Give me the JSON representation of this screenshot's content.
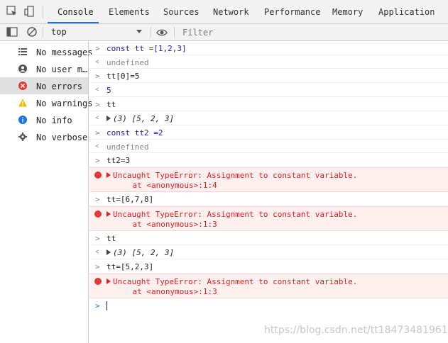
{
  "tabs": [
    "Console",
    "Elements",
    "Sources",
    "Network",
    "Performance",
    "Memory",
    "Application"
  ],
  "active_tab": "Console",
  "toolbar": {
    "context": "top",
    "filter_placeholder": "Filter"
  },
  "sidebar": [
    {
      "icon": "list-icon",
      "label": "No messages"
    },
    {
      "icon": "user-icon",
      "label": "No user m…"
    },
    {
      "icon": "error-icon",
      "label": "No errors"
    },
    {
      "icon": "warning-icon",
      "label": "No warnings"
    },
    {
      "icon": "info-icon",
      "label": "No info"
    },
    {
      "icon": "gear-icon",
      "label": "No verbose"
    }
  ],
  "console": {
    "r1": "const tt =[1,2,3]",
    "r2": "undefined",
    "r3": "tt[0]=5",
    "r4": "5",
    "r5": "tt",
    "r6": "(3) [5, 2, 3]",
    "r7": "const tt2 =2",
    "r8": "undefined",
    "r9": "tt2=3",
    "e1a": "Uncaught TypeError: Assignment to constant variable.",
    "e1b": "    at <anonymous>:1:4",
    "r10": "tt=[6,7,8]",
    "e2a": "Uncaught TypeError: Assignment to constant variable.",
    "e2b": "    at <anonymous>:1:3",
    "r11": "tt",
    "r12": "(3) [5, 2, 3]",
    "r13": "tt=[5,2,3]",
    "e3a": "Uncaught TypeError: Assignment to constant variable.",
    "e3b": "    at <anonymous>:1:3"
  },
  "watermark": "https://blog.csdn.net/tt18473481961",
  "colors": {
    "accent": "#1a73e8",
    "error": "#e53935",
    "warning": "#f5b400",
    "info": "#1a73e8"
  }
}
